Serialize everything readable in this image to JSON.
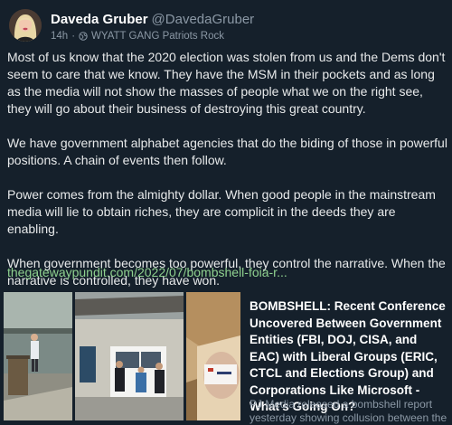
{
  "post": {
    "display_name": "Daveda Gruber",
    "handle": "@DavedaGruber",
    "time": "14h",
    "dot": "·",
    "group": "WYATT GANG Patriots Rock",
    "paragraphs": [
      "Most of us know that the 2020 election was stolen from us and the Dems don't seem to care that we know. They have the MSM in their pockets and as long as the media will not show the masses of people what we on the right see, they will go about their business of destroying this great country.",
      "We have government alphabet agencies that do the biding of those in powerful positions. A chain of events then follow.",
      "Power comes from the almighty dollar. When good people in the mainstream media will lie to obtain riches, they are complicit in the deeds they are enabling.",
      "When government becomes too powerful, they control the narrative. When the narrative is controlled, they have won."
    ],
    "link": "thegatewaypundit.com/2022/07/bombshell-foia-r..."
  },
  "card": {
    "title": "BOMBSHELL: Recent Conference Uncovered Between Government Entities (FBI, DOJ, CISA, and EAC) with Liberal Groups (ERIC, CTCL and Elections Group) and Corporations Like Microsoft - What's Going On?",
    "description": "PJ Media released a bombshell report yesterday showing collusion between the"
  },
  "icons": {
    "audience": "globe-icon"
  },
  "colors": {
    "background": "#15202b",
    "text": "#e7e9ea",
    "muted": "#8b98a5",
    "link": "#8fd18f"
  }
}
